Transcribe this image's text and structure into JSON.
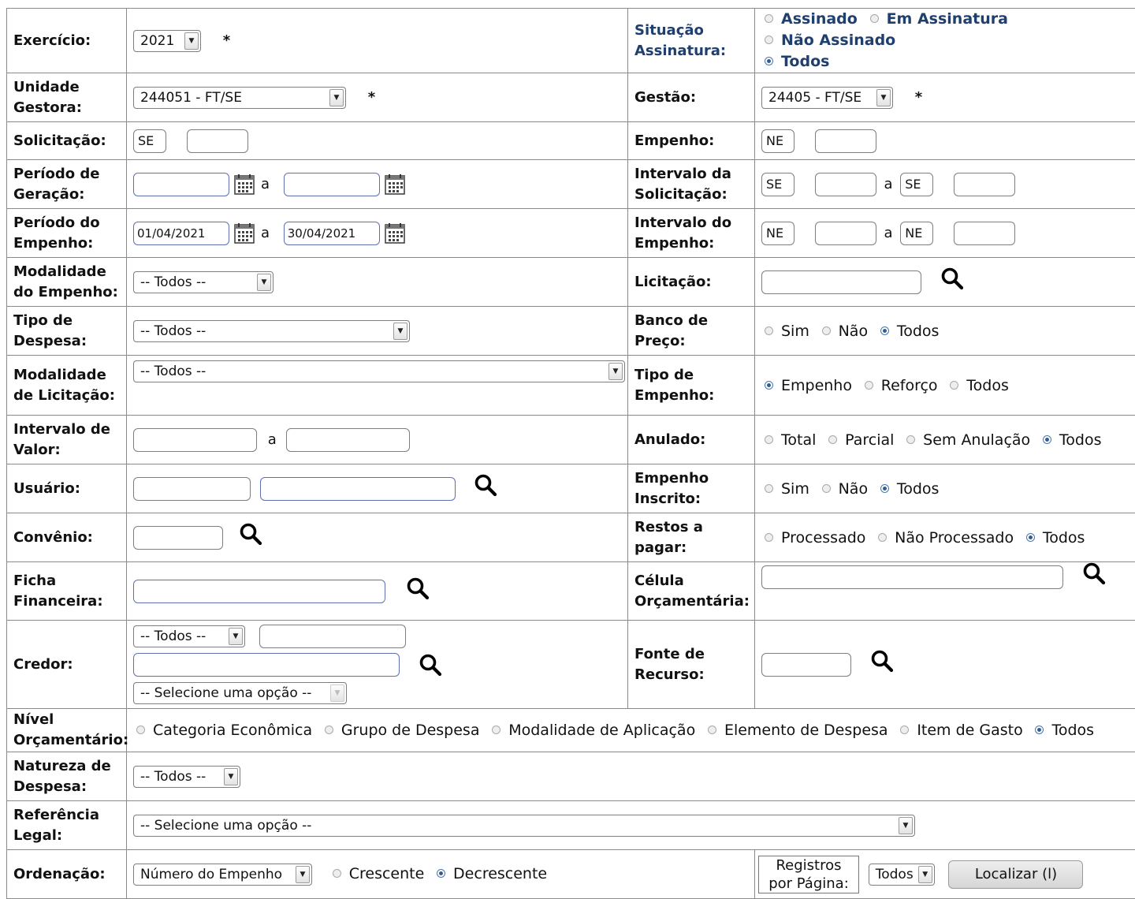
{
  "form": {
    "exercicio": {
      "label": "Exercício:",
      "value": "2021",
      "required": "*"
    },
    "situacao_assinatura": {
      "label": "Situação Assinatura:",
      "options": [
        "Assinado",
        "Em Assinatura",
        "Não Assinado",
        "Todos"
      ],
      "selected": "Todos"
    },
    "unidade_gestora": {
      "label": "Unidade Gestora:",
      "value": "244051 - FT/SE",
      "required": "*"
    },
    "gestao": {
      "label": "Gestão:",
      "value": "24405 - FT/SE",
      "required": "*"
    },
    "solicitacao": {
      "label": "Solicitação:",
      "prefix": "SE",
      "value": ""
    },
    "empenho": {
      "label": "Empenho:",
      "prefix": "NE",
      "value": ""
    },
    "periodo_geracao": {
      "label": "Período de Geração:",
      "from": "",
      "to": "",
      "separator": "a"
    },
    "intervalo_solicitacao": {
      "label": "Intervalo da Solicitação:",
      "prefix_from": "SE",
      "prefix_to": "SE",
      "separator": "a"
    },
    "periodo_empenho": {
      "label": "Período do Empenho:",
      "from": "01/04/2021",
      "to": "30/04/2021",
      "separator": "a"
    },
    "intervalo_empenho": {
      "label": "Intervalo do Empenho:",
      "prefix_from": "NE",
      "prefix_to": "NE",
      "separator": "a"
    },
    "modalidade_empenho": {
      "label": "Modalidade do Empenho:",
      "value": "-- Todos --"
    },
    "licitacao": {
      "label": "Licitação:",
      "value": ""
    },
    "tipo_despesa": {
      "label": "Tipo de Despesa:",
      "value": "-- Todos --"
    },
    "banco_preco": {
      "label": "Banco de Preço:",
      "options": [
        "Sim",
        "Não",
        "Todos"
      ],
      "selected": "Todos"
    },
    "modalidade_licitacao": {
      "label": "Modalidade de Licitação:",
      "value": "-- Todos --"
    },
    "tipo_empenho": {
      "label": "Tipo de Empenho:",
      "options": [
        "Empenho",
        "Reforço",
        "Todos"
      ],
      "selected": "Empenho"
    },
    "intervalo_valor": {
      "label": "Intervalo de Valor:",
      "separator": "a"
    },
    "anulado": {
      "label": "Anulado:",
      "options": [
        "Total",
        "Parcial",
        "Sem Anulação",
        "Todos"
      ],
      "selected": "Todos"
    },
    "usuario": {
      "label": "Usuário:"
    },
    "empenho_inscrito": {
      "label": "Empenho Inscrito:",
      "options": [
        "Sim",
        "Não",
        "Todos"
      ],
      "selected": "Todos"
    },
    "convenio": {
      "label": "Convênio:"
    },
    "restos_pagar": {
      "label": "Restos a pagar:",
      "options": [
        "Processado",
        "Não Processado",
        "Todos"
      ],
      "selected": "Todos"
    },
    "ficha_financeira": {
      "label": "Ficha Financeira:"
    },
    "celula_orcamentaria": {
      "label": "Célula Orçamentária:"
    },
    "credor": {
      "label": "Credor:",
      "type_value": "-- Todos --",
      "option_value": "-- Selecione uma opção --"
    },
    "fonte_recurso": {
      "label": "Fonte de Recurso:"
    },
    "nivel_orcamentario": {
      "label": "Nível Orçamentário:",
      "options": [
        "Categoria Econômica",
        "Grupo de Despesa",
        "Modalidade de Aplicação",
        "Elemento de Despesa",
        "Item de Gasto",
        "Todos"
      ],
      "selected": "Todos"
    },
    "natureza_despesa": {
      "label": "Natureza de Despesa:",
      "value": "-- Todos --"
    },
    "referencia_legal": {
      "label": "Referência Legal:",
      "value": "-- Selecione uma opção --"
    },
    "ordenacao": {
      "label": "Ordenação:",
      "value": "Número do Empenho",
      "options": [
        "Crescente",
        "Decrescente"
      ],
      "selected": "Decrescente"
    },
    "registros_pagina": {
      "label": "Registros por Página:",
      "value": "Todos"
    },
    "localizar_button": "Localizar (l)"
  },
  "icons": {
    "calendar": "calendar-icon",
    "search": "search-icon",
    "dropdown": "chevron-down-icon"
  },
  "colors": {
    "label_blue": "#1f3f6e",
    "radio_selected": "#2f5d96"
  }
}
